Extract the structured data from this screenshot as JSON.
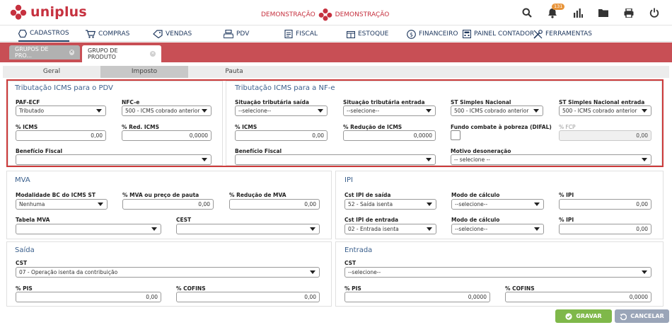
{
  "app": {
    "brand": "uniplus",
    "company_left": "DEMONSTRAÇÃO",
    "company_right": "DEMONSTRAÇÃO",
    "notifications_count": "131"
  },
  "icons": [
    "search-icon",
    "bell-icon",
    "chart-icon",
    "folder-icon",
    "print-icon",
    "power-icon"
  ],
  "menu": [
    "CADASTROS",
    "COMPRAS",
    "VENDAS",
    "PDV",
    "FISCAL",
    "ESTOQUE",
    "FINANCEIRO",
    "PAINEL CONTADOR",
    "FERRAMENTAS"
  ],
  "tabs": {
    "t1": "GRUPOS DE PRO...",
    "t2": "GRUPO DE PRODUTO"
  },
  "subtabs": [
    "Geral",
    "Imposto",
    "Pauta"
  ],
  "pdv": {
    "title": "Tributação ICMS para o PDV",
    "paf_label": "PAF-ECF",
    "paf_value": "Tributado",
    "nfce_label": "NFC-e",
    "nfce_value": "500 - ICMS cobrado anterior",
    "icms_label": "% ICMS",
    "icms_value": "0,00",
    "red_label": "% Red. ICMS",
    "red_value": "0,0000",
    "benef_label": "Benefício Fiscal",
    "benef_value": ""
  },
  "nfe": {
    "title": "Tributação ICMS para a NF-e",
    "sit_saida_label": "Situação tributária saída",
    "sit_saida_value": "--selecione--",
    "sit_entrada_label": "Situação tributária entrada",
    "sit_entrada_value": "--selecione--",
    "st_simples_label": "ST Simples Nacional",
    "st_simples_value": "500 - ICMS cobrado anterior",
    "st_simples_ent_label": "ST Simples Nacional entrada",
    "st_simples_ent_value": "500 - ICMS cobrado anterior",
    "icms_label": "% ICMS",
    "icms_value": "0,00",
    "red_label": "% Redução de ICMS",
    "red_value": "0,0000",
    "fundo_label": "Fundo combate à pobreza (DIFAL)",
    "fcp_label": "% FCP",
    "fcp_value": "0,00",
    "benef_label": "Benefício Fiscal",
    "benef_value": "",
    "motivo_label": "Motivo desoneração",
    "motivo_value": "-- selecione --"
  },
  "mva": {
    "title": "MVA",
    "mod_label": "Modalidade BC do ICMS ST",
    "mod_value": "Nenhuma",
    "mva_label": "% MVA ou preço de pauta",
    "mva_value": "0,00",
    "red_label": "% Redução de MVA",
    "red_value": "0,00",
    "tabela_label": "Tabela MVA",
    "tabela_value": "",
    "cest_label": "CEST",
    "cest_value": ""
  },
  "ipi": {
    "title": "IPI",
    "cst_saida_label": "Cst IPI de saída",
    "cst_saida_value": "52 - Saída isenta",
    "modo1_label": "Modo de cálculo",
    "modo1_value": "--selecione--",
    "ipi1_label": "% IPI",
    "ipi1_value": "0,00",
    "cst_entrada_label": "Cst IPI de entrada",
    "cst_entrada_value": "02 - Entrada isenta",
    "modo2_label": "Modo de cálculo",
    "modo2_value": "--selecione--",
    "ipi2_label": "% IPI",
    "ipi2_value": "0,00"
  },
  "saida": {
    "title": "Saída",
    "cst_label": "CST",
    "cst_value": "07 - Operação isenta da contribuição",
    "pis_label": "% PIS",
    "pis_value": "0,00",
    "cofins_label": "% COFINS",
    "cofins_value": "0,00"
  },
  "entrada": {
    "title": "Entrada",
    "cst_label": "CST",
    "cst_value": "--selecione--",
    "pis_label": "% PIS",
    "pis_value": "0,0000",
    "cofins_label": "% COFINS",
    "cofins_value": "0,0000"
  },
  "footer": {
    "save": "GRAVAR",
    "cancel": "CANCELAR"
  },
  "colors": {
    "brand": "#c6313f",
    "menu": "#20395f",
    "section_title": "#3a5f8c",
    "save": "#7fb84a",
    "cancel": "#9aa5b8"
  }
}
